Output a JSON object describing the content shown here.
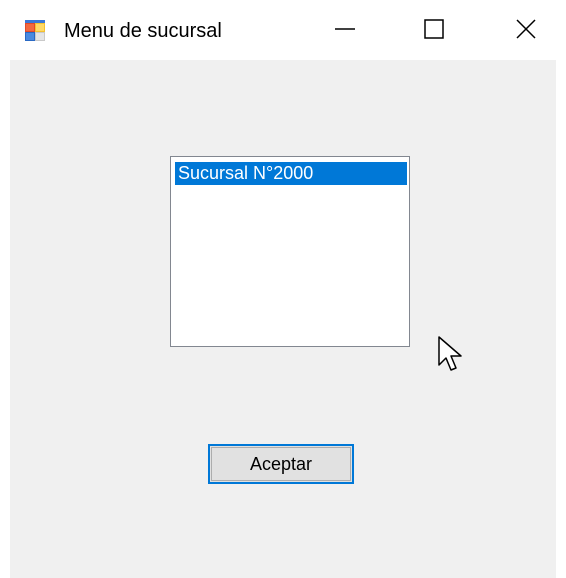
{
  "window": {
    "title": "Menu de sucursal",
    "icon": "app-window-icon",
    "controls": [
      "minimize-icon",
      "maximize-icon",
      "close-icon"
    ]
  },
  "listbox": {
    "items": [
      {
        "label": "Sucursal N°2000",
        "selected": true
      }
    ]
  },
  "buttons": {
    "accept_label": "Aceptar"
  },
  "colors": {
    "client_background": "#f0f0f0",
    "selection": "#0078d7",
    "focus_border": "#0078d7",
    "button_face": "#e1e1e1"
  }
}
